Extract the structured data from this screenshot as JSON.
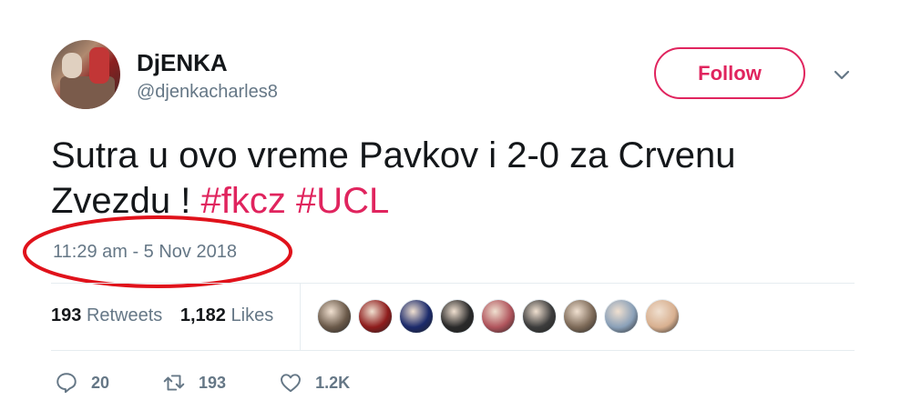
{
  "user": {
    "display_name": "DjENKA",
    "handle": "@djenkacharles8"
  },
  "follow_label": "Follow",
  "tweet": {
    "text_plain": "Sutra u ovo vreme Pavkov i 2-0 za Crvenu Zvezdu ! ",
    "hashtags": [
      "#fkcz",
      "#UCL"
    ],
    "timestamp": "11:29 am - 5 Nov 2018"
  },
  "stats": {
    "retweets_count": "193",
    "retweets_label": "Retweets",
    "likes_count": "1,182",
    "likes_label": "Likes"
  },
  "likers": [
    {
      "color": "#6b5a4a"
    },
    {
      "color": "#8e1c1c"
    },
    {
      "color": "#1b2a6b"
    },
    {
      "color": "#2a2a2a"
    },
    {
      "color": "#b0545c"
    },
    {
      "color": "#3c3c3c"
    },
    {
      "color": "#7d6a58"
    },
    {
      "color": "#8aa0b8"
    },
    {
      "color": "#d8b090"
    }
  ],
  "actions": {
    "reply": {
      "icon": "reply-icon",
      "count": "20"
    },
    "retweet": {
      "icon": "retweet-icon",
      "count": "193"
    },
    "like": {
      "icon": "heart-icon",
      "count": "1.2K"
    }
  },
  "colors": {
    "accent": "#e0245e",
    "muted": "#657786",
    "highlight_ring": "#e0121b"
  }
}
